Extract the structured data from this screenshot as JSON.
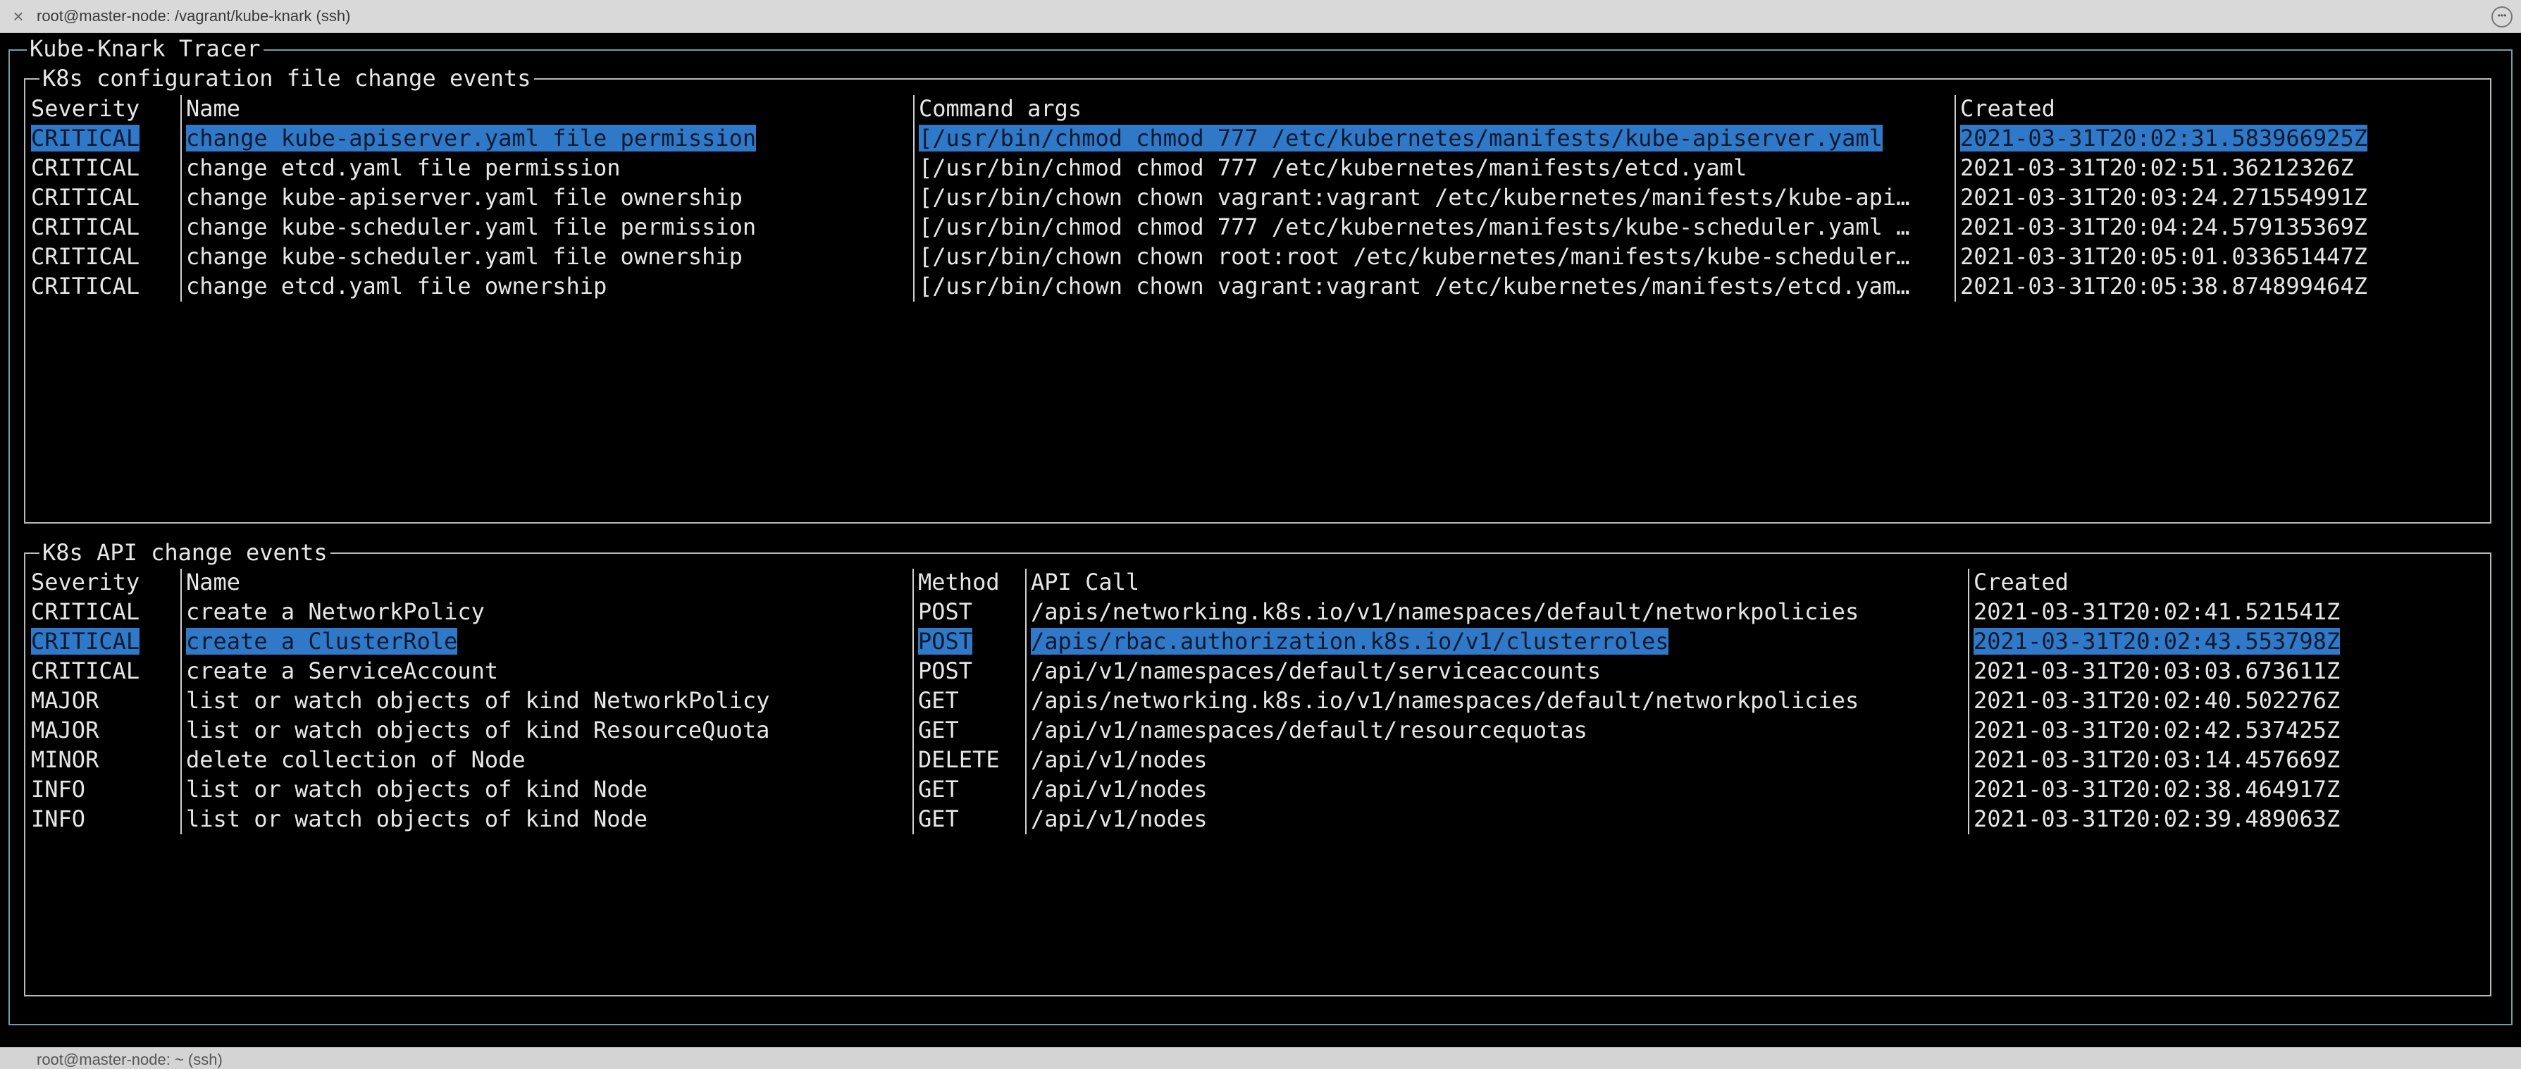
{
  "window": {
    "title": "root@master-node: /vagrant/kube-knark (ssh)",
    "bottom_title": "root@master-node: ~ (ssh)"
  },
  "app": {
    "title": "Kube-Knark Tracer"
  },
  "config_panel": {
    "title": "K8s configuration file change events",
    "headers": {
      "severity": "Severity",
      "name": "Name",
      "args": "Command args",
      "created": "Created"
    },
    "rows": [
      {
        "severity": "CRITICAL",
        "name": "change kube-apiserver.yaml file permission",
        "args": "[/usr/bin/chmod chmod 777 /etc/kubernetes/manifests/kube-apiserver.yaml",
        "created": "2021-03-31T20:02:31.583966925Z",
        "selected": true
      },
      {
        "severity": "CRITICAL",
        "name": "change etcd.yaml file permission",
        "args": "[/usr/bin/chmod chmod 777 /etc/kubernetes/manifests/etcd.yaml",
        "created": "2021-03-31T20:02:51.36212326Z",
        "selected": false
      },
      {
        "severity": "CRITICAL",
        "name": "change kube-apiserver.yaml file ownership",
        "args": "[/usr/bin/chown chown vagrant:vagrant /etc/kubernetes/manifests/kube-api…",
        "created": "2021-03-31T20:03:24.271554991Z",
        "selected": false
      },
      {
        "severity": "CRITICAL",
        "name": "change kube-scheduler.yaml file permission",
        "args": "[/usr/bin/chmod chmod 777 /etc/kubernetes/manifests/kube-scheduler.yaml …",
        "created": "2021-03-31T20:04:24.579135369Z",
        "selected": false
      },
      {
        "severity": "CRITICAL",
        "name": "change kube-scheduler.yaml file ownership",
        "args": "[/usr/bin/chown chown root:root /etc/kubernetes/manifests/kube-scheduler…",
        "created": "2021-03-31T20:05:01.033651447Z",
        "selected": false
      },
      {
        "severity": "CRITICAL",
        "name": "change etcd.yaml file ownership",
        "args": "[/usr/bin/chown chown vagrant:vagrant /etc/kubernetes/manifests/etcd.yam…",
        "created": "2021-03-31T20:05:38.874899464Z",
        "selected": false
      }
    ]
  },
  "api_panel": {
    "title": "K8s API change events",
    "headers": {
      "severity": "Severity",
      "name": "Name",
      "method": "Method",
      "api": "API Call",
      "created": "Created"
    },
    "rows": [
      {
        "severity": "CRITICAL",
        "name": "create a NetworkPolicy",
        "method": "POST",
        "api": "/apis/networking.k8s.io/v1/namespaces/default/networkpolicies",
        "created": "2021-03-31T20:02:41.521541Z",
        "selected": false
      },
      {
        "severity": "CRITICAL",
        "name": "create a ClusterRole",
        "method": "POST",
        "api": "/apis/rbac.authorization.k8s.io/v1/clusterroles",
        "created": "2021-03-31T20:02:43.553798Z",
        "selected": true
      },
      {
        "severity": "CRITICAL",
        "name": "create a ServiceAccount",
        "method": "POST",
        "api": "/api/v1/namespaces/default/serviceaccounts",
        "created": "2021-03-31T20:03:03.673611Z",
        "selected": false
      },
      {
        "severity": "MAJOR",
        "name": "list or watch objects of kind NetworkPolicy",
        "method": "GET",
        "api": "/apis/networking.k8s.io/v1/namespaces/default/networkpolicies",
        "created": "2021-03-31T20:02:40.502276Z",
        "selected": false
      },
      {
        "severity": "MAJOR",
        "name": "list or watch objects of kind ResourceQuota",
        "method": "GET",
        "api": "/api/v1/namespaces/default/resourcequotas",
        "created": "2021-03-31T20:02:42.537425Z",
        "selected": false
      },
      {
        "severity": "MINOR",
        "name": "delete collection of Node",
        "method": "DELETE",
        "api": "/api/v1/nodes",
        "created": "2021-03-31T20:03:14.457669Z",
        "selected": false
      },
      {
        "severity": "INFO",
        "name": "list or watch objects of kind Node",
        "method": "GET",
        "api": "/api/v1/nodes",
        "created": "2021-03-31T20:02:38.464917Z",
        "selected": false
      },
      {
        "severity": "INFO",
        "name": "list or watch objects of kind Node",
        "method": "GET",
        "api": "/api/v1/nodes",
        "created": "2021-03-31T20:02:39.489063Z",
        "selected": false
      }
    ]
  },
  "colors": {
    "highlight": "#2f79c8",
    "border": "#6ea0aa",
    "text": "#e6e6e6",
    "background": "#000000"
  },
  "icons": {
    "close": "close-icon",
    "menu": "more-icon"
  }
}
